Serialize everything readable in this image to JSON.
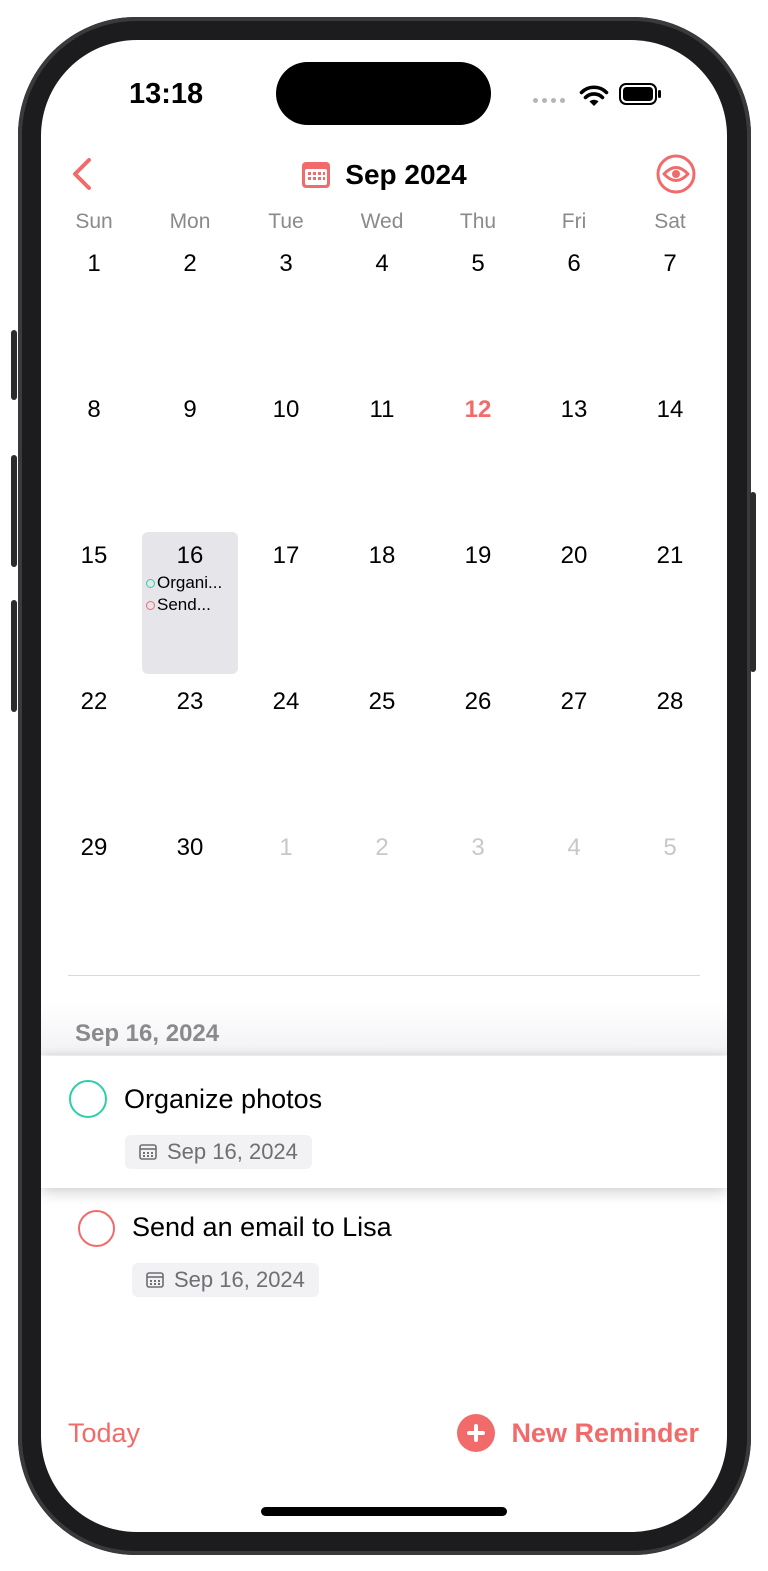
{
  "status_bar": {
    "time": "13:18"
  },
  "header": {
    "title": "Sep 2024"
  },
  "weekdays": [
    "Sun",
    "Mon",
    "Tue",
    "Wed",
    "Thu",
    "Fri",
    "Sat"
  ],
  "calendar": {
    "weeks": [
      [
        {
          "n": "1"
        },
        {
          "n": "2"
        },
        {
          "n": "3"
        },
        {
          "n": "4"
        },
        {
          "n": "5"
        },
        {
          "n": "6"
        },
        {
          "n": "7"
        }
      ],
      [
        {
          "n": "8"
        },
        {
          "n": "9"
        },
        {
          "n": "10"
        },
        {
          "n": "11"
        },
        {
          "n": "12",
          "today": true
        },
        {
          "n": "13"
        },
        {
          "n": "14"
        }
      ],
      [
        {
          "n": "15"
        },
        {
          "n": "16",
          "selected": true,
          "events": [
            {
              "label": "Organi...",
              "color": "#2ecfa8"
            },
            {
              "label": "Send...",
              "color": "#f26b6b"
            }
          ]
        },
        {
          "n": "17"
        },
        {
          "n": "18"
        },
        {
          "n": "19"
        },
        {
          "n": "20"
        },
        {
          "n": "21"
        }
      ],
      [
        {
          "n": "22"
        },
        {
          "n": "23"
        },
        {
          "n": "24"
        },
        {
          "n": "25"
        },
        {
          "n": "26"
        },
        {
          "n": "27"
        },
        {
          "n": "28"
        }
      ],
      [
        {
          "n": "29"
        },
        {
          "n": "30"
        },
        {
          "n": "1",
          "other": true
        },
        {
          "n": "2",
          "other": true
        },
        {
          "n": "3",
          "other": true
        },
        {
          "n": "4",
          "other": true
        },
        {
          "n": "5",
          "other": true
        }
      ]
    ]
  },
  "selected_date_header": "Sep 16, 2024",
  "reminders": [
    {
      "title": "Organize photos",
      "date": "Sep 16, 2024",
      "color": "#2ecfa8"
    },
    {
      "title": "Send an email to Lisa",
      "date": "Sep 16, 2024",
      "color": "#f26b6b"
    }
  ],
  "toolbar": {
    "today_label": "Today",
    "new_label": "New Reminder"
  },
  "colors": {
    "accent": "#f26b6b",
    "green": "#2ecfa8"
  }
}
